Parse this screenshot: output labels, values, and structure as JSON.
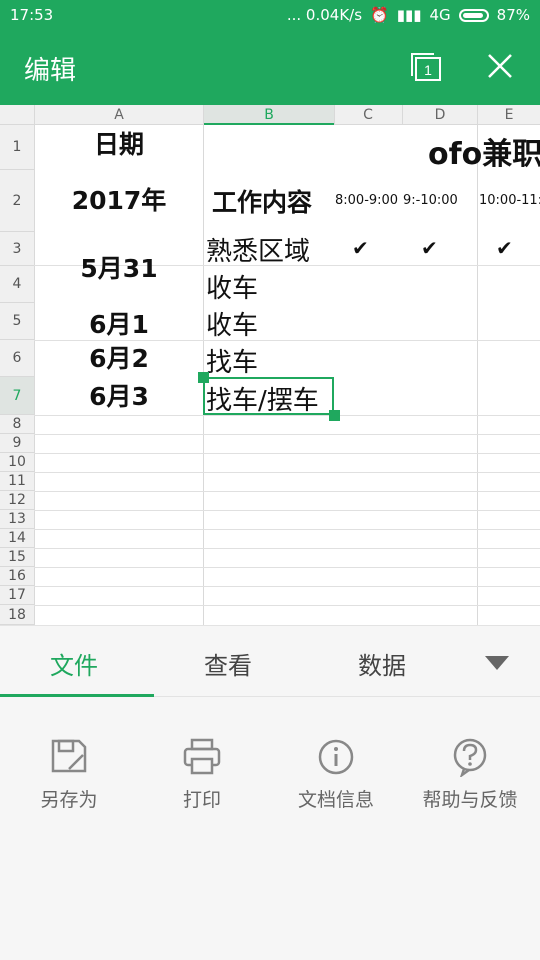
{
  "status": {
    "time": "17:53",
    "net": "... 0.04K/s",
    "network": "4G",
    "battery": "87%"
  },
  "header": {
    "title": "编辑",
    "tab_count": "1"
  },
  "sheet": {
    "columns": [
      "A",
      "B",
      "C",
      "D",
      "E"
    ],
    "rows": [
      "1",
      "2",
      "3",
      "4",
      "5",
      "6",
      "7",
      "8",
      "9",
      "10",
      "11",
      "12",
      "13",
      "14",
      "15",
      "16",
      "17",
      "18"
    ],
    "cells": {
      "a1": "日期",
      "a2": "2017年",
      "a_may31": "5月31",
      "a5": "6月1",
      "a6": "6月2",
      "a7": "6月3",
      "b2": "工作内容",
      "b3": "熟悉区域",
      "b4": "收车",
      "b5": "收车",
      "b6": "找车",
      "b7": "找车/摆车",
      "title": "ofo兼职",
      "c2": "8:00-9:00",
      "d2": "9:-10:00",
      "e2": "10:00-11:",
      "c3": "✔",
      "d3": "✔",
      "e3": "✔"
    }
  },
  "tabs": {
    "file": "文件",
    "view": "查看",
    "data": "数据"
  },
  "actions": {
    "save_as": "另存为",
    "print": "打印",
    "doc_info": "文档信息",
    "help": "帮助与反馈"
  }
}
